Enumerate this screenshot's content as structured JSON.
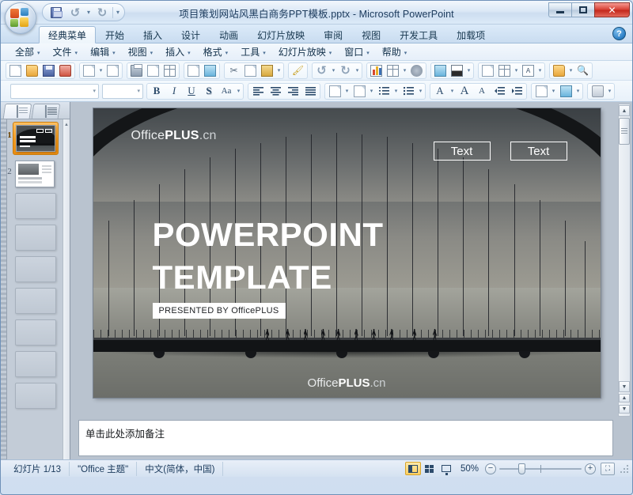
{
  "window": {
    "title": "项目策划网站风黑白商务PPT模板.pptx  -  Microsoft PowerPoint",
    "minimize_label": "",
    "maximize_label": "",
    "close_label": "✕"
  },
  "quick_access": {
    "save_icon": "save-icon",
    "undo_icon": "undo-icon",
    "redo_icon": "redo-icon",
    "customize_icon": "chevron-down-icon"
  },
  "ribbon": {
    "tabs": [
      {
        "label": "经典菜单",
        "active": true
      },
      {
        "label": "开始",
        "active": false
      },
      {
        "label": "插入",
        "active": false
      },
      {
        "label": "设计",
        "active": false
      },
      {
        "label": "动画",
        "active": false
      },
      {
        "label": "幻灯片放映",
        "active": false
      },
      {
        "label": "审阅",
        "active": false
      },
      {
        "label": "视图",
        "active": false
      },
      {
        "label": "开发工具",
        "active": false
      },
      {
        "label": "加载项",
        "active": false
      }
    ],
    "help_label": "?"
  },
  "menubar": {
    "items": [
      {
        "label": "全部"
      },
      {
        "label": "文件"
      },
      {
        "label": "编辑"
      },
      {
        "label": "视图"
      },
      {
        "label": "插入"
      },
      {
        "label": "格式"
      },
      {
        "label": "工具"
      },
      {
        "label": "幻灯片放映"
      },
      {
        "label": "窗口"
      },
      {
        "label": "帮助"
      }
    ],
    "caret": "▾"
  },
  "toolbar_row1": {
    "icons": [
      "new-document-icon",
      "open-folder-icon",
      "save-icon",
      "save-as-icon",
      "export-pdf-icon",
      "attach-icon",
      "print-icon",
      "print-preview-icon",
      "page-setup-icon",
      "spellcheck-icon",
      "research-icon",
      "cut-icon",
      "copy-icon",
      "paste-icon",
      "format-painter-icon",
      "undo-icon",
      "redo-icon",
      "insert-chart-icon",
      "insert-table-icon",
      "hyperlink-icon",
      "picture-icon",
      "fill-color-icon",
      "new-slide-icon",
      "slide-layout-icon",
      "text-box-icon",
      "slide-design-icon",
      "zoom-search-icon"
    ]
  },
  "toolbar_row2": {
    "font_name": "",
    "font_size": "",
    "buttons": [
      "bold-button",
      "italic-button",
      "underline-button",
      "shadow-button",
      "change-case-button",
      "align-left-button",
      "align-center-button",
      "align-right-button",
      "justify-button",
      "line-spacing-button",
      "text-direction-button",
      "numbered-list-button",
      "bulleted-list-button",
      "font-color-button",
      "increase-font-button",
      "decrease-font-button",
      "decrease-indent-button",
      "increase-indent-button",
      "slide-show-button",
      "custom-animation-button",
      "shape-style-button"
    ],
    "bold_label": "B",
    "italic_label": "I",
    "underline_label": "U",
    "shadow_label": "S",
    "case_label": "Aa"
  },
  "slide_pane": {
    "tab_slides": "slides-tab",
    "tab_outline": "outline-tab",
    "slides": [
      {
        "number": "1",
        "selected": true
      },
      {
        "number": "2",
        "selected": false
      }
    ],
    "empty_placeholders": 7
  },
  "slide": {
    "logo_top": {
      "pre": "Office",
      "bold": "PLUS",
      "suffix": ".cn"
    },
    "text_box_1": "Text",
    "text_box_2": "Text",
    "title_line1": "POWERPOINT",
    "title_line2": "TEMPLATE",
    "presented_by": "PRESENTED BY OfficePLUS",
    "logo_bottom": {
      "pre": "Office",
      "bold": "PLUS",
      "suffix": ".cn"
    }
  },
  "notes": {
    "placeholder_text": "单击此处添加备注"
  },
  "statusbar": {
    "slide_indicator": "幻灯片 1/13",
    "theme": "\"Office 主题\"",
    "language": "中文(简体，中国)",
    "zoom_level": "50%",
    "zoom_out_label": "−",
    "zoom_in_label": "+",
    "fit_label": "⛶",
    "views": [
      {
        "name": "normal-view-button",
        "active": true
      },
      {
        "name": "slide-sorter-button",
        "active": false
      },
      {
        "name": "slide-show-button",
        "active": false
      }
    ]
  },
  "colors": {
    "accent": "#f39a1e",
    "titlebar": "#dbe8f6",
    "close_button": "#d9463a",
    "slide_bg": "#2e3134"
  }
}
